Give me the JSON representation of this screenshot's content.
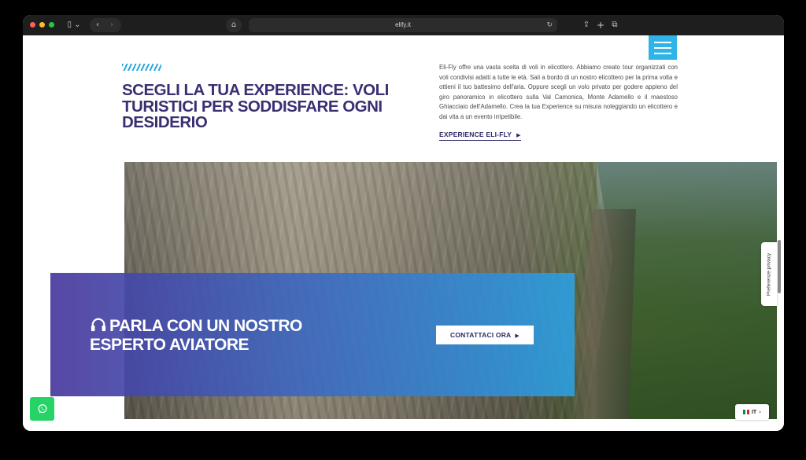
{
  "browser": {
    "url": "elify.it",
    "icons": {
      "sidebar": "sidebar-icon",
      "back": "chevron-left-icon",
      "forward": "chevron-right-icon",
      "home": "home-icon",
      "reload": "reload-icon",
      "share": "share-icon",
      "new_tab": "plus-icon",
      "tabs": "tabs-overview-icon"
    }
  },
  "intro": {
    "headline": "SCEGLI LA TUA EXPERIENCE: VOLI TURISTICI PER SODDISFARE OGNI DESIDERIO",
    "body": "Eli-Fly offre una vasta scelta di voli in elicottero. Abbiamo creato tour organizzati con voli condivisi adatti a tutte le età. Sali a bordo di un nostro elicottero per la prima volta e ottieni il tuo battesimo dell'aria. Oppure scegli un volo privato per godere appieno del giro panoramico in elicottero sulla Val Camonica, Monte Adamello e il maestoso Ghiacciaio dell'Adamello. Crea la tua Experience su misura noleggiando un elicottero e dai vita a un evento irripetibile.",
    "link_label": "EXPERIENCE ELI-FLY"
  },
  "cta": {
    "title": "PARLA CON UN NOSTRO ESPERTO AVIATORE",
    "button_label": "CONTATTACI ORA"
  },
  "privacy_tab": "Preferenze privacy",
  "language": {
    "current": "IT"
  },
  "colors": {
    "brand_dark": "#3a2f72",
    "brand_blue": "#30b4e8",
    "whatsapp": "#25d366"
  }
}
